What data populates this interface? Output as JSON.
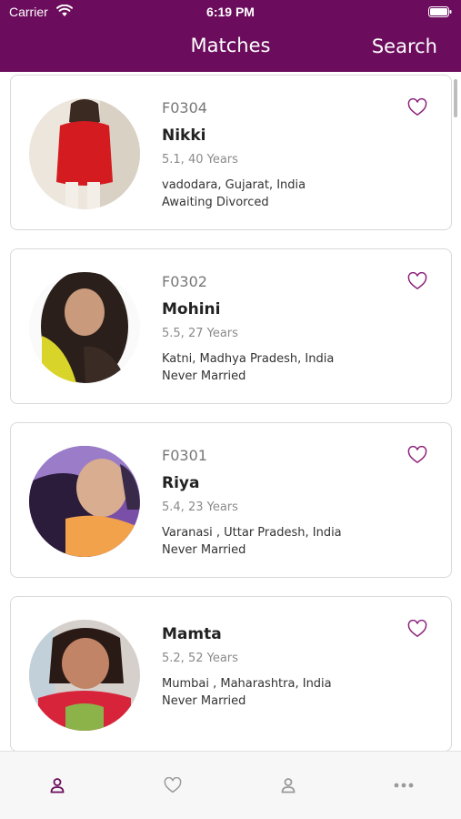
{
  "status_bar": {
    "carrier": "Carrier",
    "time": "6:19 PM"
  },
  "nav": {
    "title": "Matches",
    "search_label": "Search"
  },
  "colors": {
    "brand": "#6b0c5c",
    "tab_active": "#6b0c5c",
    "tab_inactive": "#9a9a9a"
  },
  "profiles": [
    {
      "id": "F0304",
      "name": "Nikki",
      "age": "5.1, 40 Years",
      "location": "vadodara, Gujarat, India",
      "status": "Awaiting Divorced"
    },
    {
      "id": "F0302",
      "name": "Mohini",
      "age": "5.5, 27 Years",
      "location": "Katni, Madhya Pradesh, India",
      "status": "Never Married"
    },
    {
      "id": "F0301",
      "name": "Riya",
      "age": "5.4, 23 Years",
      "location": "Varanasi , Uttar Pradesh, India",
      "status": "Never Married"
    },
    {
      "id": "",
      "name": "Mamta",
      "age": "5.2, 52 Years",
      "location": "Mumbai , Maharashtra, India",
      "status": "Never Married"
    }
  ],
  "tabs": [
    {
      "icon": "person-icon",
      "active": true
    },
    {
      "icon": "heart-icon",
      "active": false
    },
    {
      "icon": "person-icon",
      "active": false
    },
    {
      "icon": "more-icon",
      "active": false
    }
  ]
}
